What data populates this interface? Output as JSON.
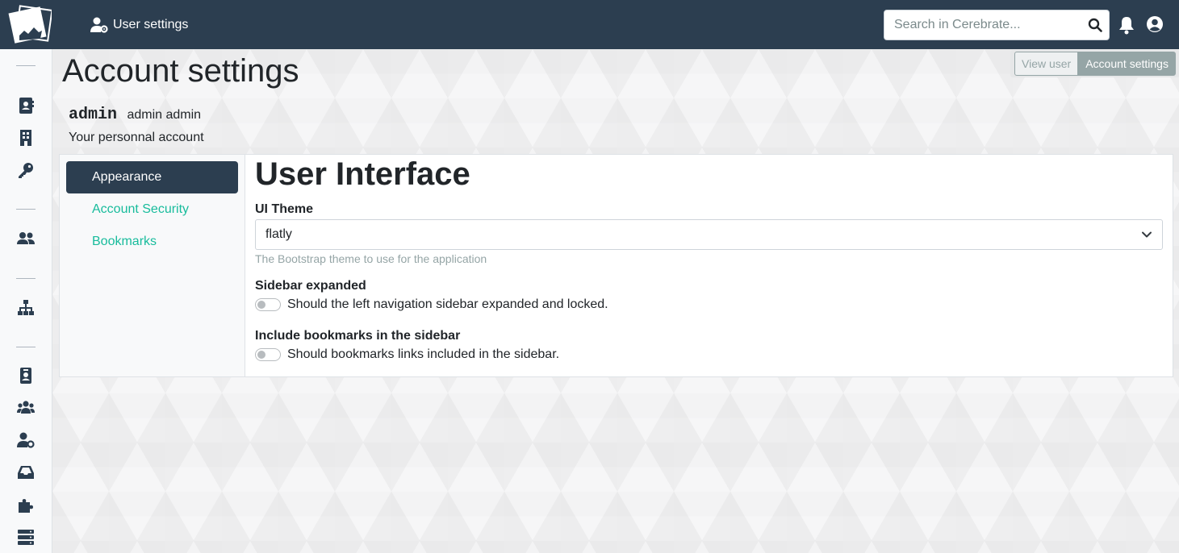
{
  "navbar": {
    "title": "User settings",
    "search_placeholder": "Search in Cerebrate..."
  },
  "page": {
    "title": "Account settings",
    "view_user_label": "View user",
    "account_settings_label": "Account settings",
    "username": "admin",
    "full_name": "admin admin",
    "description": "Your personnal account"
  },
  "settings_nav": {
    "items": [
      {
        "label": "Appearance",
        "active": true
      },
      {
        "label": "Account Security",
        "active": false
      },
      {
        "label": "Bookmarks",
        "active": false
      }
    ]
  },
  "panel": {
    "title": "User Interface",
    "ui_theme": {
      "label": "UI Theme",
      "value": "flatly",
      "help": "The Bootstrap theme to use for the application"
    },
    "sidebar_expanded": {
      "label": "Sidebar expanded",
      "description": "Should the left navigation sidebar expanded and locked.",
      "enabled": false
    },
    "include_bookmarks": {
      "label": "Include bookmarks in the sidebar",
      "description": "Should bookmarks links included in the sidebar.",
      "enabled": false
    }
  },
  "sidebar_icons": [
    "address-book-icon",
    "building-icon",
    "key-icon",
    "users-icon",
    "sitemap-icon",
    "id-badge-icon",
    "user-group-icon",
    "user-cog-icon",
    "inbox-icon",
    "puzzle-icon",
    "server-icon"
  ],
  "colors": {
    "navbar": "#2c3e50",
    "link": "#18bc9c",
    "active_nav": "#2c3e50",
    "muted": "#95a5a6"
  }
}
